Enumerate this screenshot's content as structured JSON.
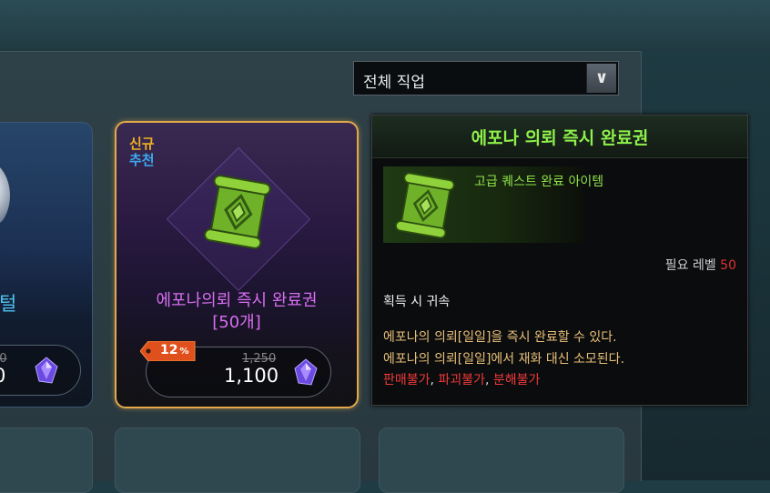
{
  "filter": {
    "job_select_value": "전체 직업"
  },
  "cards": {
    "left": {
      "name_partial": "털",
      "original_price_partial": "00",
      "price_partial": "0"
    },
    "middle": {
      "badge_new": "신규",
      "badge_recommend": "추천",
      "title_line1": "에포나의뢰 즉시 완료권",
      "title_line2": "[50개]",
      "discount": "12",
      "discount_unit": "%",
      "original_price": "1,250",
      "price": "1,100"
    }
  },
  "tooltip": {
    "item_name": "에포나 의뢰 즉시 완료권",
    "category": "고급 퀘스트 완료 아이템",
    "required_level_label": "필요 레벨",
    "required_level_value": "50",
    "bind_text": "획득 시 귀속",
    "desc_line1": "에포나의 의뢰[일일]을 즉시 완료할 수 있다.",
    "desc_line2": "에포나의 의뢰[일일]에서 재화 대신 소모된다.",
    "restrict_1": "판매불가",
    "restrict_2": "파괴불가",
    "restrict_3": "분해불가",
    "restrict_sep": ", "
  },
  "colors": {
    "item_name": "#8ef04a",
    "card_title": "#d86ef0",
    "restriction": "#f03a3a",
    "description": "#e8c078",
    "badge_new": "#f0b020",
    "badge_recommend": "#3aaaf0"
  }
}
